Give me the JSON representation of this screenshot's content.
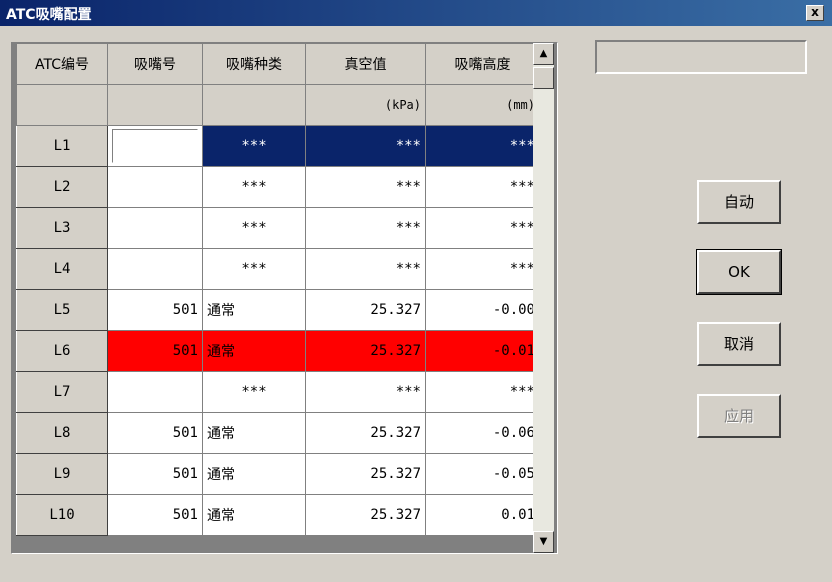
{
  "window": {
    "title": "ATC吸嘴配置",
    "close": "x"
  },
  "table": {
    "headers": [
      "ATC编号",
      "吸嘴号",
      "吸嘴种类",
      "真空值",
      "吸嘴高度"
    ],
    "units": [
      "",
      "",
      "",
      "(kPa)",
      "(mm)"
    ],
    "rows": [
      {
        "id": "L1",
        "nozzle": "",
        "type": "***",
        "vacuum": "***",
        "height": "***",
        "state": "selected"
      },
      {
        "id": "L2",
        "nozzle": "",
        "type": "***",
        "vacuum": "***",
        "height": "***",
        "state": ""
      },
      {
        "id": "L3",
        "nozzle": "",
        "type": "***",
        "vacuum": "***",
        "height": "***",
        "state": ""
      },
      {
        "id": "L4",
        "nozzle": "",
        "type": "***",
        "vacuum": "***",
        "height": "***",
        "state": ""
      },
      {
        "id": "L5",
        "nozzle": "501",
        "type": "通常",
        "vacuum": "25.327",
        "height": "-0.00",
        "state": ""
      },
      {
        "id": "L6",
        "nozzle": "501",
        "type": "通常",
        "vacuum": "25.327",
        "height": "-0.01",
        "state": "alarm"
      },
      {
        "id": "L7",
        "nozzle": "",
        "type": "***",
        "vacuum": "***",
        "height": "***",
        "state": ""
      },
      {
        "id": "L8",
        "nozzle": "501",
        "type": "通常",
        "vacuum": "25.327",
        "height": "-0.06",
        "state": ""
      },
      {
        "id": "L9",
        "nozzle": "501",
        "type": "通常",
        "vacuum": "25.327",
        "height": "-0.05",
        "state": ""
      },
      {
        "id": "L10",
        "nozzle": "501",
        "type": "通常",
        "vacuum": "25.327",
        "height": "0.01",
        "state": ""
      }
    ]
  },
  "buttons": {
    "auto": "自动",
    "ok": "OK",
    "cancel": "取消",
    "apply": "应用"
  },
  "status": {
    "text": ""
  },
  "colors": {
    "selected": "#0a246a",
    "alarm": "#ff0000",
    "face": "#d4d0c8"
  }
}
